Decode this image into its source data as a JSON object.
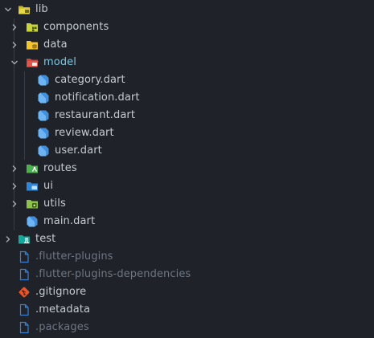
{
  "explorer": {
    "root": {
      "label": "lib",
      "expanded": true
    },
    "lib_children": [
      {
        "label": "components",
        "type": "folder",
        "icon": "components-folder-icon",
        "color": "#c9d33a"
      },
      {
        "label": "data",
        "type": "folder",
        "icon": "data-folder-icon",
        "color": "#f2c531"
      },
      {
        "label": "model",
        "type": "folder",
        "icon": "model-folder-icon",
        "color": "#e2574c",
        "expanded": true
      },
      {
        "label": "routes",
        "type": "folder",
        "icon": "routes-folder-icon",
        "color": "#5bbf55"
      },
      {
        "label": "ui",
        "type": "folder",
        "icon": "ui-folder-icon",
        "color": "#3a8fd6"
      },
      {
        "label": "utils",
        "type": "folder",
        "icon": "utils-folder-icon",
        "color": "#8bc34a"
      },
      {
        "label": "main.dart",
        "type": "file",
        "icon": "dart-icon"
      }
    ],
    "model_children": [
      {
        "label": "category.dart",
        "icon": "dart-icon"
      },
      {
        "label": "notification.dart",
        "icon": "dart-icon"
      },
      {
        "label": "restaurant.dart",
        "icon": "dart-icon"
      },
      {
        "label": "review.dart",
        "icon": "dart-icon"
      },
      {
        "label": "user.dart",
        "icon": "dart-icon"
      }
    ],
    "test": {
      "label": "test",
      "icon": "test-folder-icon",
      "color": "#1ab6a3"
    },
    "root_files": [
      {
        "label": ".flutter-plugins",
        "icon": "file-icon",
        "dim": true
      },
      {
        "label": ".flutter-plugins-dependencies",
        "icon": "file-icon",
        "dim": true
      },
      {
        "label": ".gitignore",
        "icon": "git-icon",
        "dim": false
      },
      {
        "label": ".metadata",
        "icon": "file-icon",
        "dim": false
      },
      {
        "label": ".packages",
        "icon": "file-icon",
        "dim": true
      }
    ]
  },
  "colors": {
    "background": "#1f2228",
    "text": "#c6cbd3",
    "dim_text": "#6f7681",
    "active_text": "#7fc6de",
    "dart_blue": "#3f8fe0",
    "file_blue": "#3a7fd0",
    "git_orange": "#e8552a"
  }
}
